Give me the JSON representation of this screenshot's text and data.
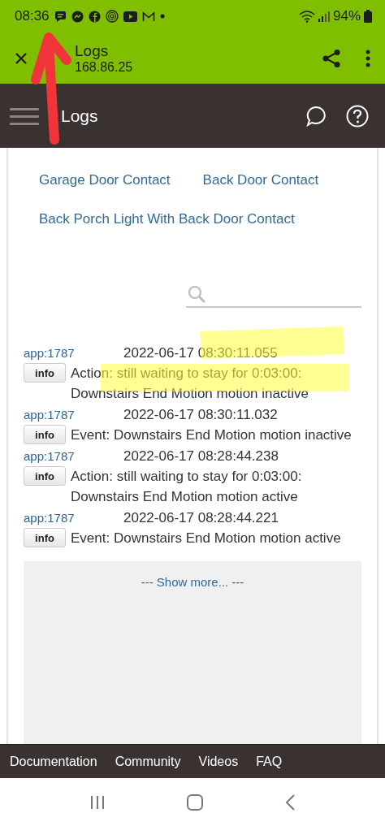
{
  "status_bar": {
    "time": "08:36",
    "battery": "94%"
  },
  "app_bar": {
    "title": "Logs",
    "subtitle": "168.86.25"
  },
  "header": {
    "title": "Logs"
  },
  "device_links": [
    {
      "label": "Garage Door Contact"
    },
    {
      "label": "Back Door Contact"
    },
    {
      "label": "Back Porch Light With Back Door Contact"
    }
  ],
  "logs": [
    {
      "source": "app:1787",
      "timestamp": "2022-06-17 08:30:11.055",
      "level": "info",
      "message": "Action: still waiting to stay for 0:03:00: Downstairs End Motion motion inactive",
      "highlighted": true
    },
    {
      "source": "app:1787",
      "timestamp": "2022-06-17 08:30:11.032",
      "level": "info",
      "message": "Event: Downstairs End Motion motion inactive",
      "highlighted": false
    },
    {
      "source": "app:1787",
      "timestamp": "2022-06-17 08:28:44.238",
      "level": "info",
      "message": "Action: still waiting to stay for 0:03:00: Downstairs End Motion motion active",
      "highlighted": false
    },
    {
      "source": "app:1787",
      "timestamp": "2022-06-17 08:28:44.221",
      "level": "info",
      "message": "Event: Downstairs End Motion motion active",
      "highlighted": false
    }
  ],
  "show_more": "--- Show more... ---",
  "footer_links": [
    {
      "label": "Documentation"
    },
    {
      "label": "Community"
    },
    {
      "label": "Videos"
    },
    {
      "label": "FAQ"
    }
  ],
  "annotations": [
    {
      "kind": "arrow"
    }
  ]
}
